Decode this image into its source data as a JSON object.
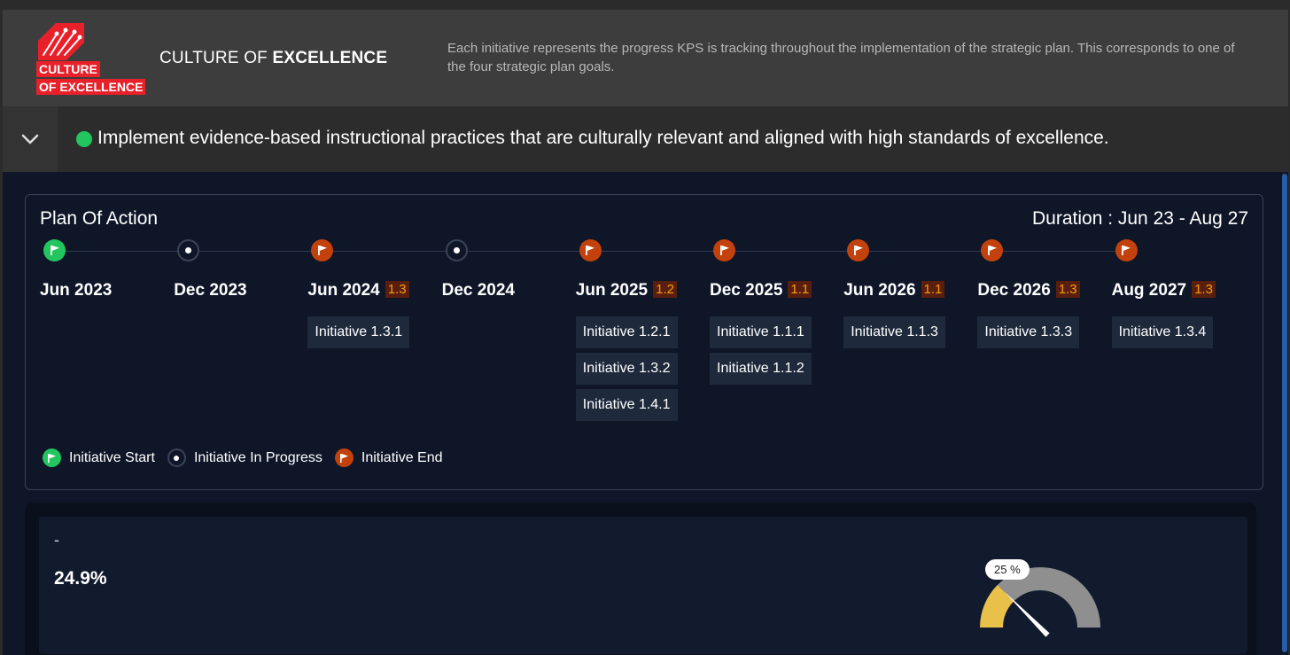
{
  "header": {
    "logo_line1": "CULTURE",
    "logo_line2": "OF EXCELLENCE",
    "title_prefix": "CULTURE OF ",
    "title_bold": "EXCELLENCE",
    "description": "Each initiative represents the progress KPS is tracking throughout the implementation of the strategic plan. This corresponds to one of the four strategic plan goals."
  },
  "goal": {
    "text": "Implement evidence-based instructional practices that are culturally relevant and aligned with high standards of excellence.",
    "status_color": "#22c55e"
  },
  "plan": {
    "title": "Plan Of Action",
    "duration": "Duration : Jun 23 - Aug 27",
    "milestones": [
      {
        "date": "Jun 2023",
        "type": "start",
        "badge": "",
        "initiatives": []
      },
      {
        "date": "Dec 2023",
        "type": "progress",
        "badge": "",
        "initiatives": []
      },
      {
        "date": "Jun 2024",
        "type": "end",
        "badge": "1.3",
        "initiatives": [
          "Initiative 1.3.1"
        ]
      },
      {
        "date": "Dec 2024",
        "type": "progress",
        "badge": "",
        "initiatives": []
      },
      {
        "date": "Jun 2025",
        "type": "end",
        "badge": "1.2",
        "initiatives": [
          "Initiative 1.2.1",
          "Initiative 1.3.2",
          "Initiative 1.4.1"
        ]
      },
      {
        "date": "Dec 2025",
        "type": "end",
        "badge": "1.1",
        "initiatives": [
          "Initiative 1.1.1",
          "Initiative 1.1.2"
        ]
      },
      {
        "date": "Jun 2026",
        "type": "end",
        "badge": "1.1",
        "initiatives": [
          "Initiative 1.1.3"
        ]
      },
      {
        "date": "Dec 2026",
        "type": "end",
        "badge": "1.3",
        "initiatives": [
          "Initiative 1.3.3"
        ]
      },
      {
        "date": "Aug 2027",
        "type": "end",
        "badge": "1.3",
        "initiatives": [
          "Initiative 1.3.4"
        ]
      }
    ],
    "legend": {
      "start": "Initiative Start",
      "progress": "Initiative In Progress",
      "end": "Initiative End"
    }
  },
  "kpi": {
    "label": "-",
    "value": "24.9%",
    "gauge_label": "25 %",
    "gauge_fraction": 0.25
  },
  "colors": {
    "start": "#22c55e",
    "end": "#c2410c",
    "gauge_fill": "#e9c04a",
    "gauge_track": "#8f8f8f"
  }
}
